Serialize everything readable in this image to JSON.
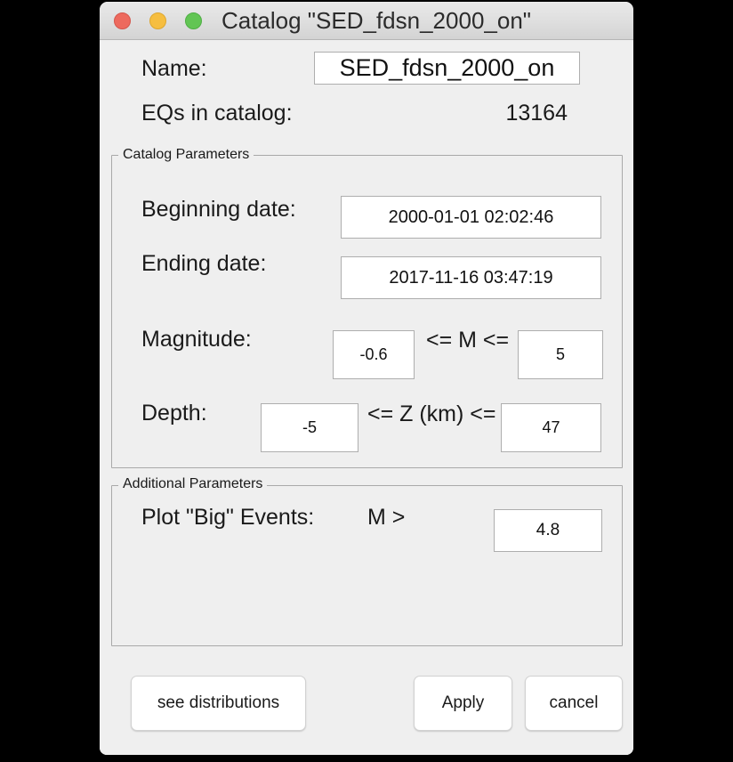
{
  "window": {
    "title": "Catalog \"SED_fdsn_2000_on\"",
    "traffic_lights": {
      "close_color": "#ed6a5e",
      "minimize_color": "#f6be40",
      "zoom_color": "#62c554"
    }
  },
  "header": {
    "name_label": "Name:",
    "name_value": "SED_fdsn_2000_on",
    "count_label": "EQs in catalog:",
    "count_value": "13164"
  },
  "catalog_parameters": {
    "legend": "Catalog Parameters",
    "beginning_date_label": "Beginning date:",
    "beginning_date_value": "2000-01-01 02:02:46",
    "ending_date_label": "Ending date:",
    "ending_date_value": "2017-11-16 03:47:19",
    "magnitude_label": "Magnitude:",
    "magnitude_min": "-0.6",
    "magnitude_operator": "<= M <=",
    "magnitude_max": "5",
    "depth_label": "Depth:",
    "depth_min": "-5",
    "depth_operator": "<= Z (km) <=",
    "depth_max": "47"
  },
  "additional_parameters": {
    "legend": "Additional Parameters",
    "big_events_label": "Plot \"Big\" Events:",
    "big_events_operator": "M >",
    "big_events_value": "4.8"
  },
  "buttons": {
    "see_distributions": "see distributions",
    "apply": "Apply",
    "cancel": "cancel"
  }
}
